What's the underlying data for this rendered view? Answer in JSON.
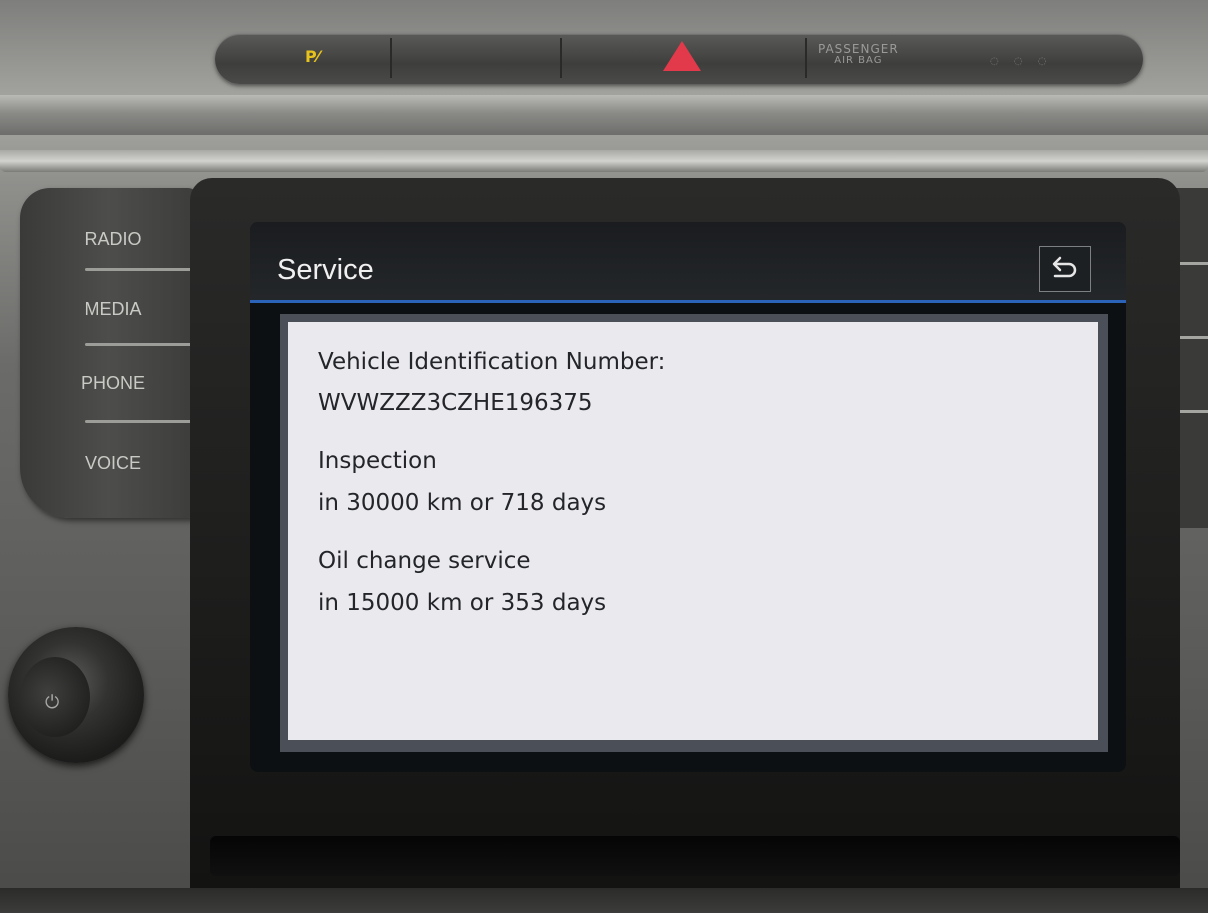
{
  "dashboard": {
    "hazard_bar": {
      "passenger_airbag_line1": "PASSENGER",
      "passenger_airbag_line2": "AIR BAG"
    },
    "side_buttons": {
      "radio": "RADIO",
      "media": "MEDIA",
      "phone": "PHONE",
      "voice": "VOICE"
    }
  },
  "screen": {
    "title": "Service",
    "back_icon": "back-arrow-icon",
    "vin_label": "Vehicle Identification Number:",
    "vin_value": "WVWZZZ3CZHE196375",
    "inspection_label": "Inspection",
    "inspection_value": "in 30000 km or 718 days",
    "oil_label": "Oil change service",
    "oil_value": "in 15000 km or 353 days"
  },
  "colors": {
    "accent_line": "#2a63b8",
    "hazard": "#e23a4b",
    "park_assist": "#e7c31c"
  }
}
